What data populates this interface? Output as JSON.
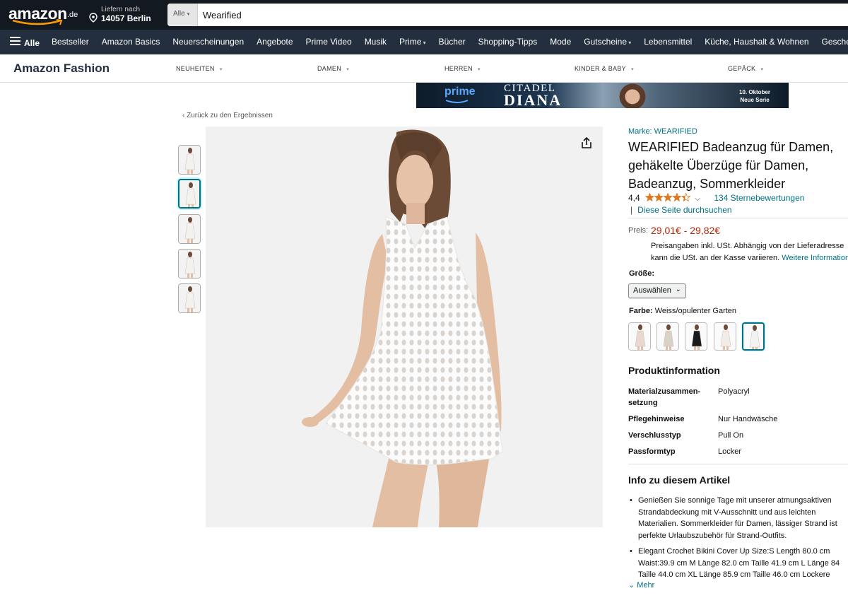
{
  "header": {
    "logo_text": "amazon",
    "logo_tld": ".de",
    "deliver_line1": "Liefern nach",
    "deliver_line2": "14057 Berlin",
    "search_category": "Alle",
    "search_value": "Wearified"
  },
  "nav": {
    "all_label": "Alle",
    "items": [
      {
        "label": "Bestseller",
        "dropdown": false
      },
      {
        "label": "Amazon Basics",
        "dropdown": false
      },
      {
        "label": "Neuerscheinungen",
        "dropdown": false
      },
      {
        "label": "Angebote",
        "dropdown": false
      },
      {
        "label": "Prime Video",
        "dropdown": false
      },
      {
        "label": "Musik",
        "dropdown": false
      },
      {
        "label": "Prime",
        "dropdown": true
      },
      {
        "label": "Bücher",
        "dropdown": false
      },
      {
        "label": "Shopping-Tipps",
        "dropdown": false
      },
      {
        "label": "Mode",
        "dropdown": false
      },
      {
        "label": "Gutscheine",
        "dropdown": true
      },
      {
        "label": "Lebensmittel",
        "dropdown": false
      },
      {
        "label": "Küche, Haushalt & Wohnen",
        "dropdown": false
      },
      {
        "label": "Geschenkideen",
        "dropdown": false
      }
    ]
  },
  "fashion_bar": {
    "brand": "Amazon Fashion",
    "items": [
      "NEUHEITEN",
      "DAMEN",
      "HERREN",
      "KINDER & BABY",
      "GEPÄCK"
    ]
  },
  "banner": {
    "prime": "prime",
    "title1": "CITADEL",
    "title2": "DIANA",
    "date1": "10. Oktober",
    "date2": "Neue Serie"
  },
  "breadcrumb": "‹ Zurück zu den Ergebnissen",
  "product": {
    "brand_link": "Marke: WEARIFIED",
    "title": "WEARIFIED Badeanzug für Damen, gehäkelte Überzüge für Damen, Badeanzug, Sommerkleider",
    "rating_value": "4,4",
    "rating_stars": 4.4,
    "rating_count": "134 Sternebewertungen",
    "page_search": "Diese Seite durchsuchen",
    "price_label": "Preis:",
    "price": "29,01€ - 29,82€",
    "tax_line1": "Preisangaben inkl. USt. Abhängig von der Lieferadresse",
    "tax_line2": "kann die USt. an der Kasse variieren.",
    "tax_link": "Weitere Informationen",
    "size_label": "Größe:",
    "size_value": "Auswählen",
    "color_label": "Farbe:",
    "color_value": "Weiss/opulenter Garten",
    "swatch_colors": [
      "#e8d8cf",
      "#d9d2c6",
      "#1a1a1a",
      "#f1ece8",
      "#f2f2f2"
    ],
    "selected_swatch": 4,
    "thumbnails": 5,
    "selected_thumb": 1
  },
  "product_info": {
    "heading": "Produktinformation",
    "rows": [
      {
        "key": "Materialzusammen-setzung",
        "value": "Polyacryl"
      },
      {
        "key": "Pflegehinweise",
        "value": "Nur Handwäsche"
      },
      {
        "key": "Verschlusstyp",
        "value": "Pull On"
      },
      {
        "key": "Passformtyp",
        "value": "Locker"
      }
    ]
  },
  "about": {
    "heading": "Info zu diesem Artikel",
    "bullets": [
      [
        "Genießen Sie sonnige Tage mit unserer atmungsaktiven",
        "Strandabdeckung mit V-Ausschnitt und aus leichten",
        "Materialien. Sommerkleider für Damen, lässiger Strand ist",
        "perfekte Urlaubszubehör für Strand-Outfits."
      ],
      [
        "Elegant Crochet Bikini Cover Up Size:S Length 80.0 cm",
        "Waist:39.9 cm M Länge 82.0 cm Taille 41.9 cm L Länge 84",
        "Taille 44.0 cm XL Länge 85.9 cm Taille 46.0 cm Lockere"
      ]
    ],
    "more": "Mehr"
  },
  "colors": {
    "nav_dark": "#131921",
    "nav_main": "#232f3e",
    "link": "#007185",
    "price": "#b12704",
    "star": "#de7921"
  }
}
